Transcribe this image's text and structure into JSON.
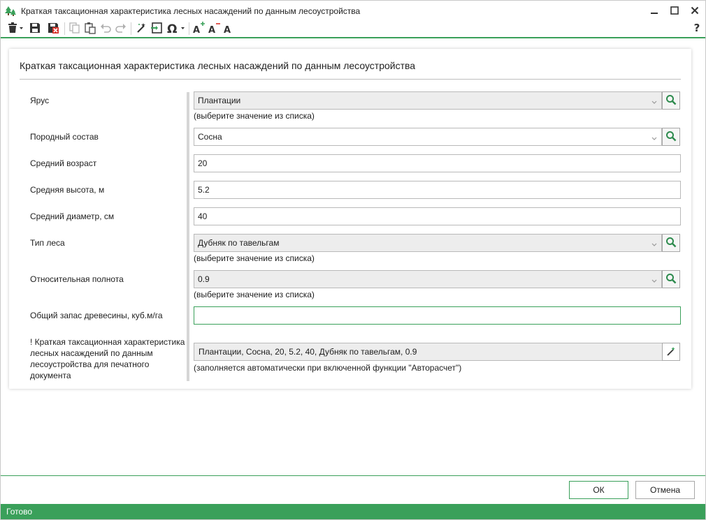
{
  "window": {
    "title": "Краткая таксационная характеристика лесных насаждений по данным лесоустройства"
  },
  "toolbar": {
    "icons": [
      "delete-dropdown-icon",
      "save-icon",
      "save-close-icon",
      "copy-icon",
      "paste-icon",
      "undo-icon",
      "redo-icon",
      "magic-wand-icon",
      "import-icon",
      "omega-symbol-icon",
      "font-increase-icon",
      "font-decrease-icon",
      "font-reset-icon",
      "help-icon"
    ],
    "help_label": "?"
  },
  "form": {
    "title": "Краткая таксационная характеристика лесных насаждений по данным лесоустройства",
    "fields": {
      "yarus": {
        "label": "Ярус",
        "value": "Плантации",
        "hint": "(выберите значение из списка)"
      },
      "porodny": {
        "label": "Породный состав",
        "value": "Сосна"
      },
      "vozrast": {
        "label": "Средний возраст",
        "value": "20"
      },
      "vysota": {
        "label": "Средняя высота, м",
        "value": "5.2"
      },
      "diametr": {
        "label": "Средний диаметр, см",
        "value": "40"
      },
      "tip_lesa": {
        "label": "Тип леса",
        "value": "Дубняк по тавельгам",
        "hint": "(выберите значение из списка)"
      },
      "polnota": {
        "label": "Относительная полнота",
        "value": "0.9",
        "hint": "(выберите значение из списка)"
      },
      "zapas": {
        "label": "Общий запас древесины, куб.м/га",
        "value": ""
      },
      "summary": {
        "label": "! Краткая таксационная характеристика лесных насаждений по данным лесоустройства для печатного документа",
        "value": "Плантации, Сосна, 20, 5.2, 40, Дубняк по тавельгам, 0.9",
        "hint": "(заполняется автоматически при включенной функции \"Авторасчет\")"
      }
    }
  },
  "buttons": {
    "ok": "ОК",
    "cancel": "Отмена"
  },
  "status": {
    "text": "Готово"
  },
  "colors": {
    "accent": "#3aa05a",
    "search_icon": "#2e8b4e"
  }
}
